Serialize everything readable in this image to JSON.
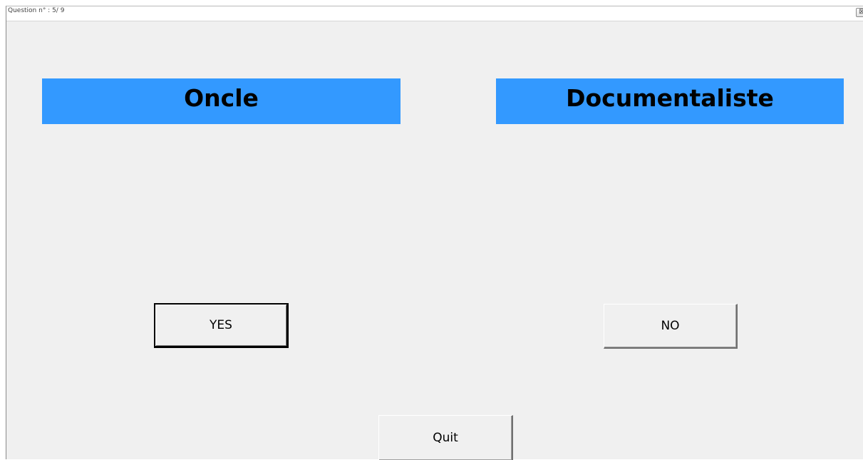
{
  "window": {
    "title": "Question n° : 5/ 9",
    "close_symbol": "⊠"
  },
  "words": {
    "left": "Oncle",
    "right": "Documentaliste"
  },
  "buttons": {
    "yes": "YES",
    "no": "NO",
    "quit": "Quit"
  },
  "colors": {
    "word_background": "#3399ff",
    "window_background": "#f0f0f0"
  },
  "icons": {
    "close": "close-icon"
  }
}
